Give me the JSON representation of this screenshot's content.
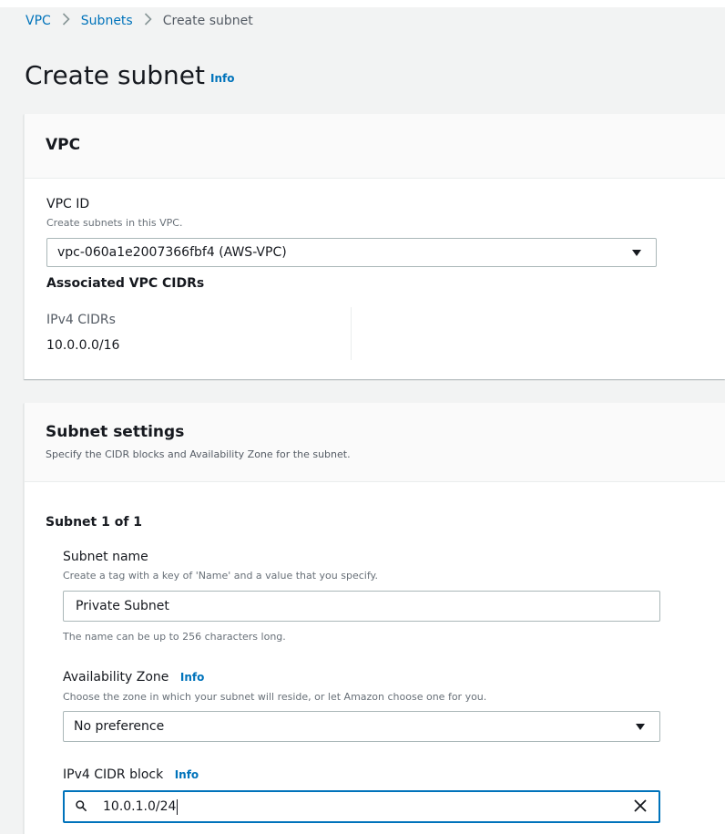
{
  "breadcrumb": {
    "items": [
      "VPC",
      "Subnets"
    ],
    "current": "Create subnet"
  },
  "page": {
    "title": "Create subnet",
    "info": "Info"
  },
  "vpc_panel": {
    "heading": "VPC",
    "vpc_id_label": "VPC ID",
    "vpc_id_description": "Create subnets in this VPC.",
    "vpc_id_value": "vpc-060a1e2007366fbf4 (AWS-VPC)",
    "associated_heading": "Associated VPC CIDRs",
    "ipv4_cidrs_label": "IPv4 CIDRs",
    "ipv4_cidrs_value": "10.0.0.0/16"
  },
  "subnet_panel": {
    "heading": "Subnet settings",
    "description": "Specify the CIDR blocks and Availability Zone for the subnet.",
    "subnet_counter": "Subnet 1 of 1",
    "subnet_name_label": "Subnet name",
    "subnet_name_description": "Create a tag with a key of 'Name' and a value that you specify.",
    "subnet_name_value": "Private Subnet",
    "subnet_name_hint": "The name can be up to 256 characters long.",
    "az_label": "Availability Zone",
    "az_info": "Info",
    "az_description": "Choose the zone in which your subnet will reside, or let Amazon choose one for you.",
    "az_value": "No preference",
    "cidr_label": "IPv4 CIDR block",
    "cidr_info": "Info",
    "cidr_value": "10.0.1.0/24"
  },
  "colors": {
    "link": "#0073bb",
    "text": "#16191f",
    "background": "#f2f3f3",
    "focus": "#0073bb"
  },
  "icons": [
    "chevron-right-icon",
    "caret-down-icon",
    "search-icon",
    "close-icon"
  ]
}
